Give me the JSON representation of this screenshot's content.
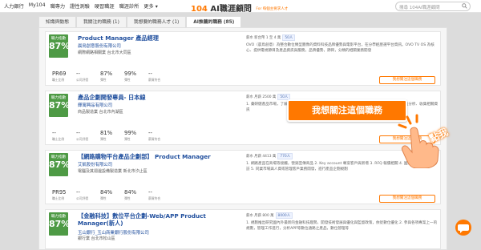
{
  "nav": [
    "人力銀行",
    "My104",
    "職專力",
    "證性測驗",
    "硬習職涯",
    "職涯診所",
    "更多 ▾"
  ],
  "brand": {
    "num": "104",
    "name": "AI職涯顧問",
    "tag": "For 每個主要求人才"
  },
  "search": {
    "placeholder": "搜尋 104AI職涯顧問"
  },
  "tabs": [
    "知識與動態",
    "我關注的職務 (1)",
    "我想要的職務人才 (1)",
    "AI推薦的職務 (85)"
  ],
  "score_label": "職力指數",
  "stat_labels": [
    "職士比例",
    "公司評價",
    "彈性",
    "彈性",
    "薪資符合"
  ],
  "follow_label": "我想關注這個職務",
  "callout": "我想關注這個職務",
  "tap": "點我",
  "cards": [
    {
      "title": "Product Manager 產品經理",
      "company": "晨鳥創意股份有限公司",
      "industry": "網際網路相關業  台北市大同區",
      "score": "87%",
      "stats": [
        "PR69",
        "--",
        "87%",
        "99%",
        "--"
      ],
      "meta": "薪水 新台幣 1 至 4 萬",
      "meta_pill": "50人",
      "desc": "OVO（晨鳥創意）為整合數位類型圖像的資料科技品牌優勢與電影平台，在分學經歷選平台資訊。OVO TV OS 為核心、提供電視節目及產品資訊與服務，品牌優勢，節目，分類的相關業務開發"
    },
    {
      "title": "產品企劃開發專員- 日本線",
      "company": "輝寓興品有限公司",
      "industry": "商品製造業  台北市內湖區",
      "score": "87%",
      "stats": [
        "--",
        "--",
        "81%",
        "99%",
        "--"
      ],
      "meta": "薪水 月薪 2500 萬",
      "meta_pill": "50人",
      "desc": "1. 彙研健產品市場，了解日本生活產品相關資訊 2. 品牌市場分析 3. 參與新產品企劃與開發 4. 選品分析、收集相關資訊"
    },
    {
      "title": "【網路購物平台產品企劃部】 Product Manager",
      "company": "艾凱股份有限公司",
      "industry": "電腦及其週邊設備製造業  新北市汐止區",
      "score": "87%",
      "stats": [
        "PR95",
        "--",
        "84%",
        "84%",
        "--"
      ],
      "meta": "薪水 月薪 4413 萬",
      "meta_pill": "770人",
      "desc": "1. 網路產品在商場等接觸，營銷宣傳商品 2. Key account 專案客戶與新增 3. RFQ 報價相關 4. 國內外參展與客戶拜訪 5. 同業市場與人資或管理客戶業務開發，進行產品企劃規劃"
    },
    {
      "title": "【金融科技】數位平台企劃-Web/APP Product Manager(新人)",
      "company": "玉山銀行_玉山商業銀行股份有限公司",
      "industry": "銀行業  台北市松山區",
      "score": "87%",
      "stats": [
        "--",
        "--",
        "--",
        "--",
        "--"
      ],
      "meta": "薪水 月薪 800 萬",
      "meta_pill": "8000人",
      "desc": "1. 規劃推出研究國內外最新的金融科技趨勢，開發技術發展與優化與監督政策，依從數位優化 2. 參與各項專案上一的規劃，管理工作進行，分析APP等數位通路之產品，數位管理等"
    }
  ]
}
